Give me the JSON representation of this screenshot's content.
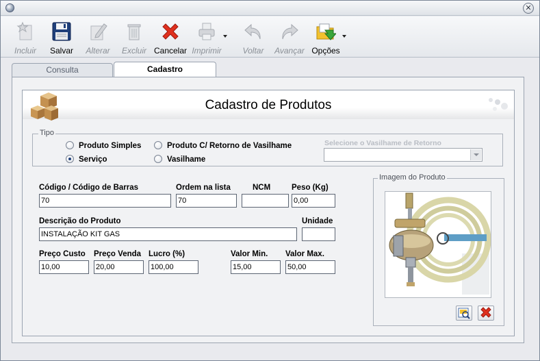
{
  "toolbar": {
    "buttons": [
      {
        "label": "Incluir",
        "icon": "new-star-icon",
        "enabled": false
      },
      {
        "label": "Salvar",
        "icon": "floppy-disk-icon",
        "enabled": true
      },
      {
        "label": "Alterar",
        "icon": "edit-pencil-icon",
        "enabled": false
      },
      {
        "label": "Excluir",
        "icon": "trash-can-icon",
        "enabled": false
      },
      {
        "label": "Cancelar",
        "icon": "red-x-icon",
        "enabled": true
      },
      {
        "label": "Imprimir",
        "icon": "printer-icon",
        "enabled": false
      },
      {
        "label": "Voltar",
        "icon": "back-arrow-icon",
        "enabled": false
      },
      {
        "label": "Avançar",
        "icon": "forward-arrow-icon",
        "enabled": false
      },
      {
        "label": "Opções",
        "icon": "options-folder-icon",
        "enabled": true
      }
    ]
  },
  "tabs": [
    {
      "label": "Consulta",
      "active": false
    },
    {
      "label": "Cadastro",
      "active": true
    }
  ],
  "header": {
    "title": "Cadastro de Produtos"
  },
  "tipo": {
    "legend": "Tipo",
    "options": [
      {
        "label": "Produto Simples",
        "selected": false
      },
      {
        "label": "Serviço",
        "selected": true
      },
      {
        "label": "Produto C/ Retorno de Vasilhame",
        "selected": false
      },
      {
        "label": "Vasilhame",
        "selected": false
      }
    ],
    "vasilhame_label": "Selecione o Vasilhame de Retorno",
    "vasilhame_value": ""
  },
  "fields": {
    "codigo": {
      "label": "Código / Código de  Barras",
      "value": "70"
    },
    "ordem": {
      "label": "Ordem na lista",
      "value": "70"
    },
    "ncm": {
      "label": "NCM",
      "value": ""
    },
    "peso": {
      "label": "Peso (Kg)",
      "value": "0,00"
    },
    "descricao": {
      "label": "Descrição do Produto",
      "value": "INSTALAÇÃO KIT GAS"
    },
    "unidade": {
      "label": "Unidade",
      "value": ""
    },
    "preco_custo": {
      "label": "Preço Custo",
      "value": "10,00"
    },
    "preco_venda": {
      "label": "Preço Venda",
      "value": "20,00"
    },
    "lucro": {
      "label": "Lucro (%)",
      "value": "100,00"
    },
    "valor_min": {
      "label": "Valor Min.",
      "value": "15,00"
    },
    "valor_max": {
      "label": "Valor Max.",
      "value": "50,00"
    }
  },
  "imagem": {
    "legend": "Imagem do Produto",
    "picture": "gas-regulator-hose-photo"
  },
  "colors": {
    "cancel_red": "#e0301e",
    "save_blue": "#1f3f7a",
    "options_green": "#3aa63a"
  }
}
